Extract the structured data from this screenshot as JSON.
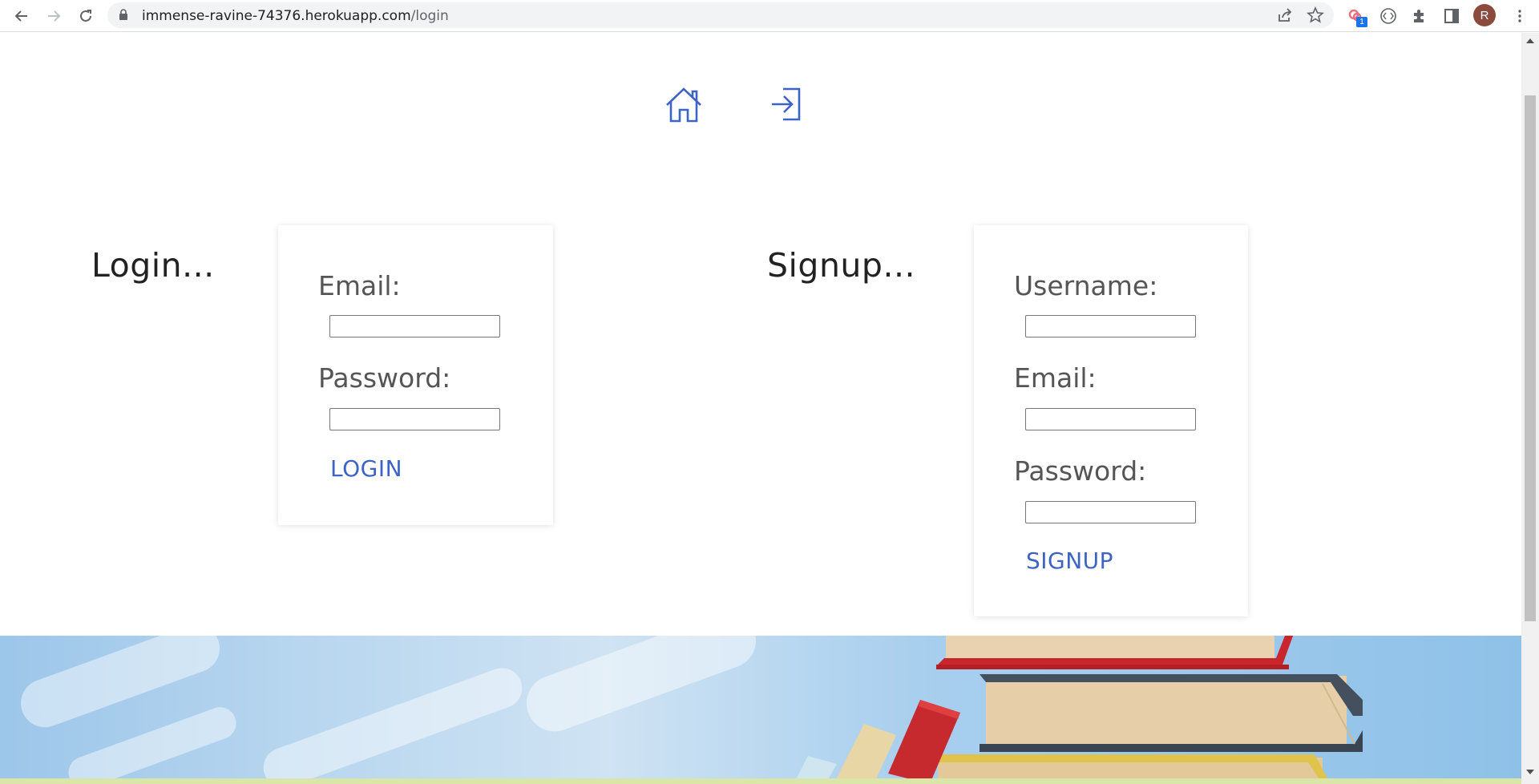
{
  "browser": {
    "url_host": "immense-ravine-74376.herokuapp.com",
    "url_path": "/login",
    "extension_badge": "1",
    "profile_initial": "R"
  },
  "nav": {
    "home_icon": "home-icon",
    "login_icon": "sign-in-icon"
  },
  "login": {
    "heading": "Login...",
    "email_label": "Email:",
    "email_value": "",
    "password_label": "Password:",
    "password_value": "",
    "button_label": "LOGIN"
  },
  "signup": {
    "heading": "Signup...",
    "username_label": "Username:",
    "username_value": "",
    "email_label": "Email:",
    "email_value": "",
    "password_label": "Password:",
    "password_value": "",
    "button_label": "SIGNUP"
  },
  "colors": {
    "accent": "#3d63c4",
    "label": "#555555",
    "heading": "#222222"
  }
}
